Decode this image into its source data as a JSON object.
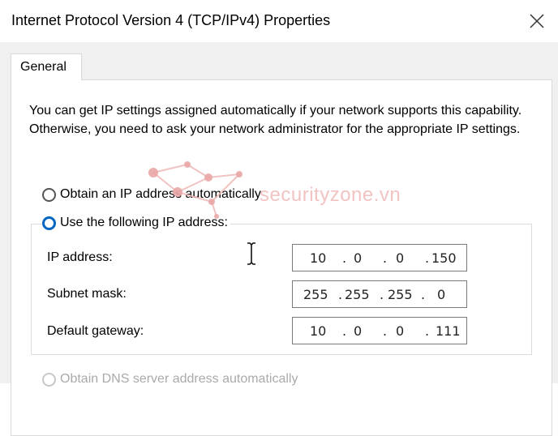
{
  "window": {
    "title": "Internet Protocol Version 4 (TCP/IPv4) Properties",
    "close_icon": "close-icon"
  },
  "tabs": [
    {
      "label": "General"
    }
  ],
  "description": "You can get IP settings assigned automatically if your network supports this capability. Otherwise, you need to ask your network administrator for the appropriate IP settings.",
  "ip_mode": {
    "auto_label": "Obtain an IP address automatically",
    "manual_label": "Use the following IP address:",
    "selected": "manual"
  },
  "fields": {
    "ip_address": {
      "label": "IP address:",
      "octets": [
        "10",
        "0",
        "0",
        "150"
      ]
    },
    "subnet_mask": {
      "label": "Subnet mask:",
      "octets": [
        "255",
        "255",
        "255",
        "0"
      ]
    },
    "default_gateway": {
      "label": "Default gateway:",
      "octets": [
        "10",
        "0",
        "0",
        "111"
      ]
    }
  },
  "dns": {
    "auto_label": "Obtain DNS server address automatically"
  },
  "watermark": {
    "text": "securityzone.vn"
  },
  "colors": {
    "accent": "#0067c0",
    "dialog_bg": "#f0f0f0",
    "watermark": "#e9a3a3"
  }
}
